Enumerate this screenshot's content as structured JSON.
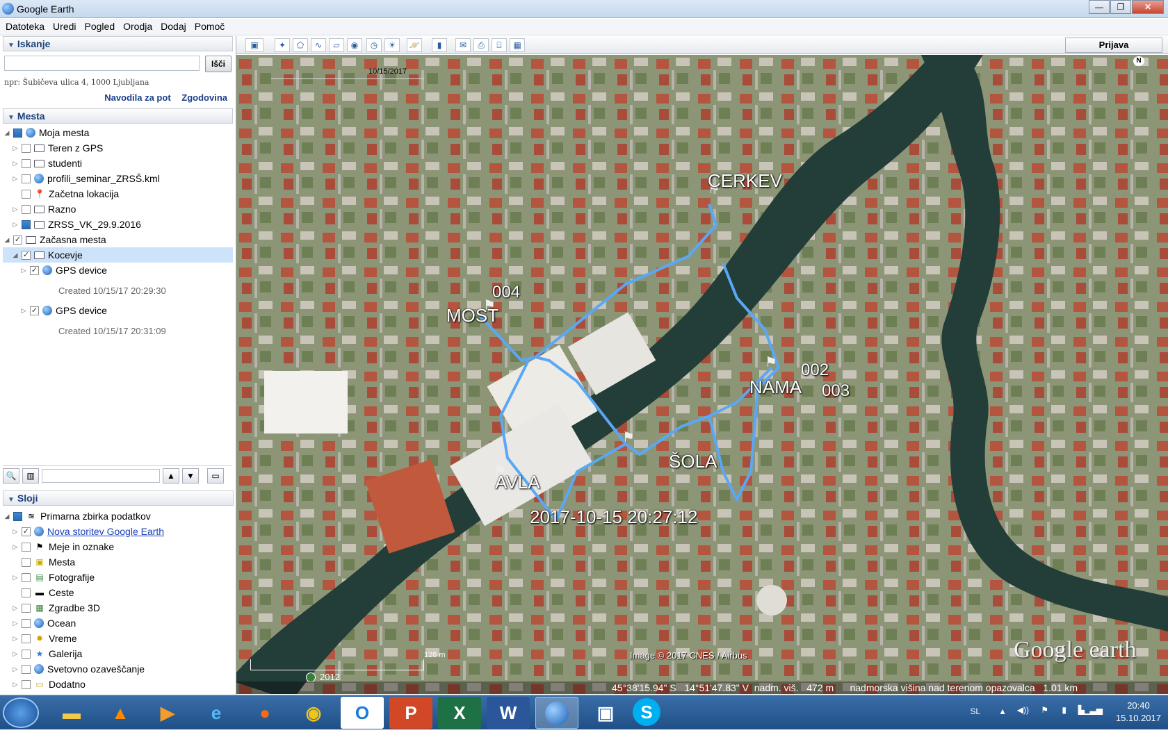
{
  "window": {
    "title": "Google Earth"
  },
  "menu": [
    "Datoteka",
    "Uredi",
    "Pogled",
    "Orodja",
    "Dodaj",
    "Pomoč"
  ],
  "search": {
    "header": "Iskanje",
    "placeholder": "",
    "button": "Išči",
    "hint": "npr: Šubičeva ulica 4, 1000 Ljubljana",
    "link_directions": "Navodila za pot",
    "link_history": "Zgodovina"
  },
  "places": {
    "header": "Mesta",
    "items": [
      {
        "label": "Moja mesta"
      },
      {
        "label": "Teren z GPS"
      },
      {
        "label": "studenti"
      },
      {
        "label": "profili_seminar_ZRSŠ.kml"
      },
      {
        "label": "Začetna lokacija"
      },
      {
        "label": "Razno"
      },
      {
        "label": "ZRSS_VK_29.9.2016"
      },
      {
        "label": "Začasna mesta"
      },
      {
        "label": "Kocevje"
      },
      {
        "label": "GPS device",
        "sub": "Created 10/15/17 20:29:30"
      },
      {
        "label": "GPS device",
        "sub": "Created 10/15/17 20:31:09"
      }
    ]
  },
  "layers": {
    "header": "Sloji",
    "items": [
      {
        "label": "Primarna zbirka podatkov"
      },
      {
        "label": "Nova storitev Google Earth"
      },
      {
        "label": "Meje in oznake"
      },
      {
        "label": "Mesta"
      },
      {
        "label": "Fotografije"
      },
      {
        "label": "Ceste"
      },
      {
        "label": "Zgradbe 3D"
      },
      {
        "label": "Ocean"
      },
      {
        "label": "Vreme"
      },
      {
        "label": "Galerija"
      },
      {
        "label": "Svetovno ozaveščanje"
      },
      {
        "label": "Dodatno"
      }
    ]
  },
  "toolbar": {
    "signin": "Prijava"
  },
  "map": {
    "date_slider": "10/15/2017",
    "labels": {
      "cerkev": "CERKEV",
      "most": "MOST",
      "p004": "004",
      "p002": "002",
      "p003": "003",
      "nama": "NAMA",
      "sola": "ŠOLA",
      "avla": "AVLA",
      "timestamp": "2017-10-15 20:27:12"
    },
    "attribution": "Image © 2017 CNES / Airbus",
    "brand": "Google earth",
    "scale": "128 m",
    "year": "2012",
    "status": "45°38'15.94\" S   14°51'47.83\" V  nadm. viš.   472 m      nadmorska višina nad terenom opazovalca   1.01 km",
    "north": "N"
  },
  "taskbar": {
    "lang": "SL",
    "time": "20:40",
    "date": "15.10.2017"
  },
  "colors": {
    "track": "#5aa8f5",
    "river": "#1f3a36",
    "water_stroke": "#23423e"
  }
}
